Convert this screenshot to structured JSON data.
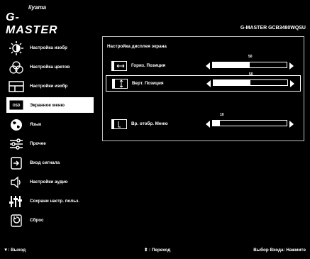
{
  "brand": {
    "top": "iiyama",
    "main": "G-MASTER"
  },
  "model": "G-MASTER GCB3480WQSU",
  "sidebar": {
    "items": [
      {
        "label": "Настройка изобр",
        "icon": "brightness-icon"
      },
      {
        "label": "Настройка цветов",
        "icon": "color-palette-icon"
      },
      {
        "label": "Настройки изобр",
        "icon": "picture-icon"
      },
      {
        "label": "Экранное меню",
        "icon": "osd-icon",
        "active": true
      },
      {
        "label": "Язык",
        "icon": "globe-icon"
      },
      {
        "label": "Прочее",
        "icon": "sliders-icon"
      },
      {
        "label": "Вход сигнала",
        "icon": "input-icon"
      },
      {
        "label": "Настройки аудио",
        "icon": "speaker-icon"
      },
      {
        "label": "Сохрани настр. польз.",
        "icon": "equalizer-icon"
      },
      {
        "label": "Сброс",
        "icon": "reset-icon"
      }
    ]
  },
  "panel": {
    "title": "Настройка дисплея экрана",
    "rows": [
      {
        "label": "Гориз. Позиция",
        "value": "50",
        "fraction": 0.5,
        "selected": false
      },
      {
        "label": "Верт. Позиция",
        "value": "50",
        "fraction": 0.5,
        "selected": true
      },
      {
        "label": "Вр. отобр. Меню",
        "value": "10",
        "fraction": 0.1,
        "selected": false
      }
    ]
  },
  "footer": {
    "exit": "▼: Выход",
    "navigate": "⬍ : Переход",
    "input_select": "Выбор Входа: Нажмите"
  }
}
